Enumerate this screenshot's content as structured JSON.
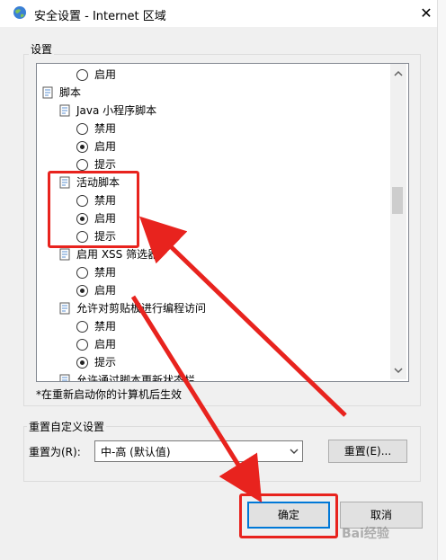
{
  "window": {
    "title": "安全设置 - Internet 区域",
    "close_glyph": "✕"
  },
  "settings_label": "设置",
  "tree": [
    {
      "type": "radio",
      "text": "启用",
      "checked": false
    },
    {
      "type": "folder",
      "text": "脚本"
    },
    {
      "type": "folder",
      "text": "Java 小程序脚本"
    },
    {
      "type": "radio",
      "text": "禁用",
      "checked": false
    },
    {
      "type": "radio",
      "text": "启用",
      "checked": true
    },
    {
      "type": "radio",
      "text": "提示",
      "checked": false
    },
    {
      "type": "folder",
      "text": "活动脚本"
    },
    {
      "type": "radio",
      "text": "禁用",
      "checked": false
    },
    {
      "type": "radio",
      "text": "启用",
      "checked": true
    },
    {
      "type": "radio",
      "text": "提示",
      "checked": false
    },
    {
      "type": "folder",
      "text": "启用 XSS 筛选器"
    },
    {
      "type": "radio",
      "text": "禁用",
      "checked": false
    },
    {
      "type": "radio",
      "text": "启用",
      "checked": true
    },
    {
      "type": "folder",
      "text": "允许对剪贴板进行编程访问"
    },
    {
      "type": "radio",
      "text": "禁用",
      "checked": false
    },
    {
      "type": "radio",
      "text": "启用",
      "checked": false
    },
    {
      "type": "radio",
      "text": "提示",
      "checked": true
    },
    {
      "type": "folder",
      "text": "允许通过脚本更新状态栏"
    }
  ],
  "restart_note": "*在重新启动你的计算机后生效",
  "reset_group_label": "重置自定义设置",
  "reset_to_label": "重置为(R):",
  "reset_select_value": "中-高 (默认值)",
  "reset_button": "重置(E)...",
  "ok_button": "确定",
  "cancel_button": "取消",
  "watermark": "Bai经验",
  "colors": {
    "highlight": "#e8231e",
    "window_bg": "#f0f0f0"
  }
}
